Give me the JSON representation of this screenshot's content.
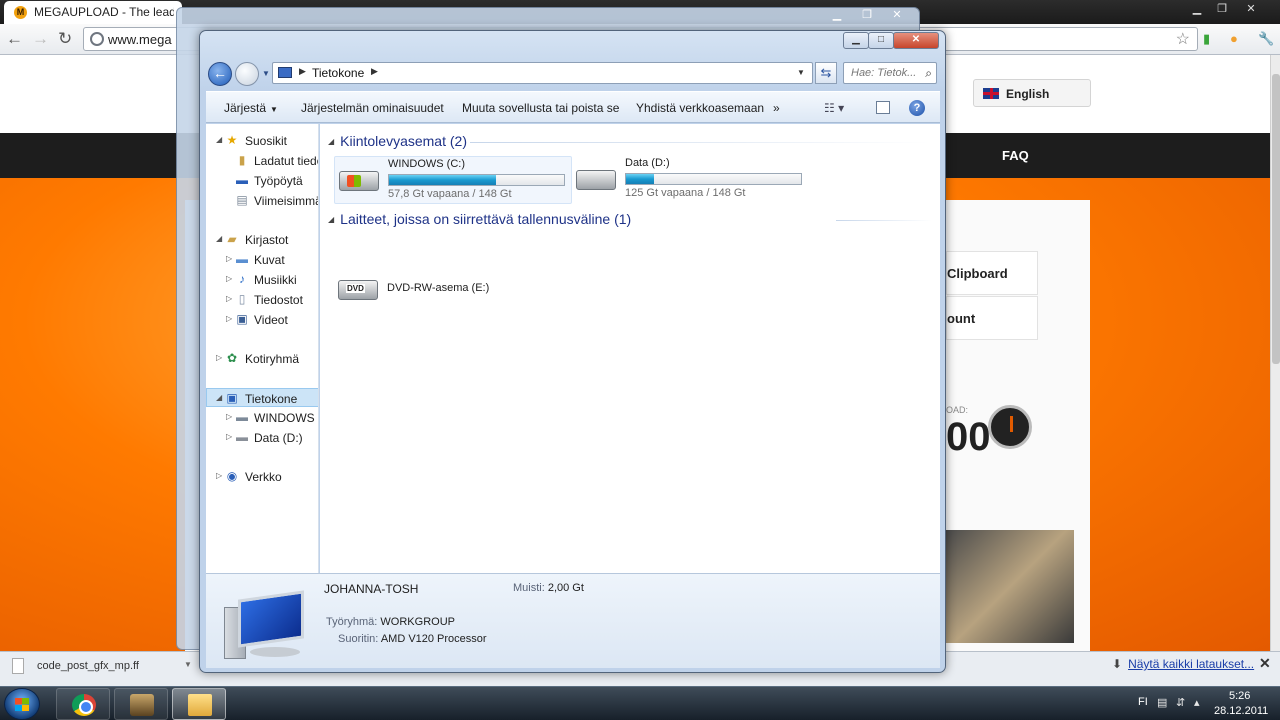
{
  "browser": {
    "tab_title": "MEGAUPLOAD - The leadin",
    "tab_favicon_letter": "M",
    "url": "www.mega",
    "language_label": "English",
    "faq_label": "FAQ",
    "menu_clipboard": "Clipboard",
    "menu_account": "ount",
    "download_label": "OAD:",
    "download_count": "00",
    "download_file": "code_post_gfx_mp.ff",
    "show_all_downloads": "Näytä kaikki lataukset..."
  },
  "explorer": {
    "address_location": "Tietokone",
    "search_placeholder": "Hae: Tietok...",
    "commands": {
      "organize": "Järjestä",
      "system_properties": "Järjestelmän ominaisuudet",
      "uninstall": "Muuta sovellusta tai poista se",
      "map_drive": "Yhdistä verkkoasemaan",
      "more": "»"
    },
    "nav": {
      "favorites": "Suosikit",
      "downloads": "Ladatut tiedo",
      "desktop": "Työpöytä",
      "recent": "Viimeisimmä",
      "libraries": "Kirjastot",
      "pictures": "Kuvat",
      "music": "Musiikki",
      "documents": "Tiedostot",
      "videos": "Videot",
      "homegroup": "Kotiryhmä",
      "computer": "Tietokone",
      "windows_drive": "WINDOWS (C",
      "data_drive": "Data (D:)",
      "network": "Verkko"
    },
    "groups": {
      "hard_drives": "Kiintolevyasemat (2)",
      "removable": "Laitteet, joissa on siirrettävä tallennusväline (1)"
    },
    "drives": [
      {
        "name": "WINDOWS (C:)",
        "free_text": "57,8 Gt vapaana / 148 Gt",
        "used_fraction": 0.61
      },
      {
        "name": "Data (D:)",
        "free_text": "125 Gt vapaana / 148 Gt",
        "used_fraction": 0.16
      }
    ],
    "dvd": {
      "name": "DVD-RW-asema (E:)",
      "badge": "DVD"
    },
    "details": {
      "computer_name": "JOHANNA-TOSH",
      "memory_label": "Muisti:",
      "memory_value": "2,00 Gt",
      "workgroup_label": "Työryhmä:",
      "workgroup_value": "WORKGROUP",
      "processor_label": "Suoritin:",
      "processor_value": "AMD V120 Processor"
    }
  },
  "taskbar": {
    "language": "FI",
    "time": "5:26",
    "date": "28.12.2011"
  },
  "colors": {
    "drive_bar_fill": "#1a9ad0",
    "site_orange": "#ff7a00",
    "explorer_frame": "#bfd2ea"
  }
}
